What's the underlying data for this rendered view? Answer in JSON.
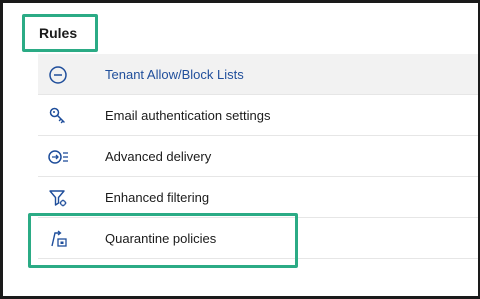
{
  "section": {
    "title": "Rules"
  },
  "rules": [
    {
      "label": "Tenant Allow/Block Lists",
      "icon": "block-circle-icon",
      "selected": true
    },
    {
      "label": "Email authentication settings",
      "icon": "key-icon",
      "selected": false
    },
    {
      "label": "Advanced delivery",
      "icon": "delivery-icon",
      "selected": false
    },
    {
      "label": "Enhanced filtering",
      "icon": "filter-gear-icon",
      "selected": false
    },
    {
      "label": "Quarantine policies",
      "icon": "quarantine-icon",
      "selected": false
    }
  ],
  "colors": {
    "accent_highlight": "#2bab85",
    "selected_text": "#1f4e9b",
    "icon": "#1f4e9b",
    "selected_background": "#f2f2f2"
  }
}
